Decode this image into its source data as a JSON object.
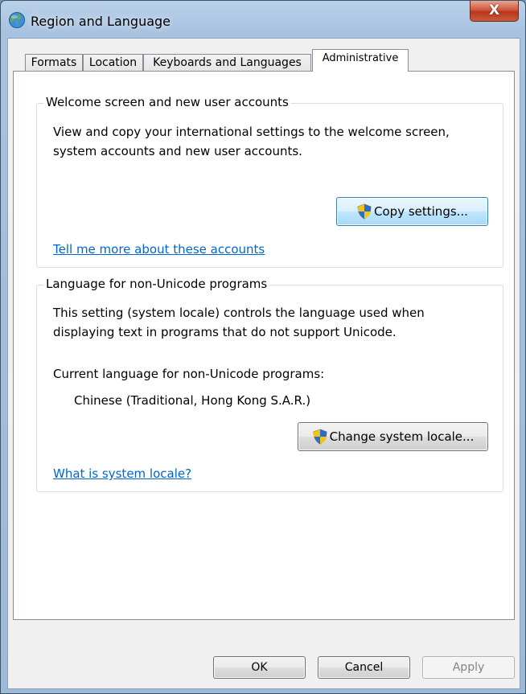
{
  "window": {
    "title": "Region and Language",
    "close_label": "X"
  },
  "tabs": [
    {
      "label": "Formats"
    },
    {
      "label": "Location"
    },
    {
      "label": "Keyboards and Languages"
    },
    {
      "label": "Administrative"
    }
  ],
  "welcome_group": {
    "title": "Welcome screen and new user accounts",
    "description_line1": "View and copy your international settings to the welcome screen,",
    "description_line2": "system accounts and new user accounts.",
    "copy_button": "Copy settings...",
    "link": "Tell me more about these accounts"
  },
  "locale_group": {
    "title": "Language for non-Unicode programs",
    "description_line1": "This setting (system locale) controls the language used when",
    "description_line2": "displaying text in programs that do not support Unicode.",
    "current_label": "Current language for non-Unicode programs:",
    "current_value": "Chinese (Traditional, Hong Kong S.A.R.)",
    "change_button": "Change system locale...",
    "link": "What is system locale?"
  },
  "footer": {
    "ok": "OK",
    "cancel": "Cancel",
    "apply": "Apply"
  },
  "colors": {
    "link": "#0066cc",
    "close_button": "#c8452a"
  },
  "icons": {
    "app": "globe-icon",
    "uac": "uac-shield-icon"
  }
}
